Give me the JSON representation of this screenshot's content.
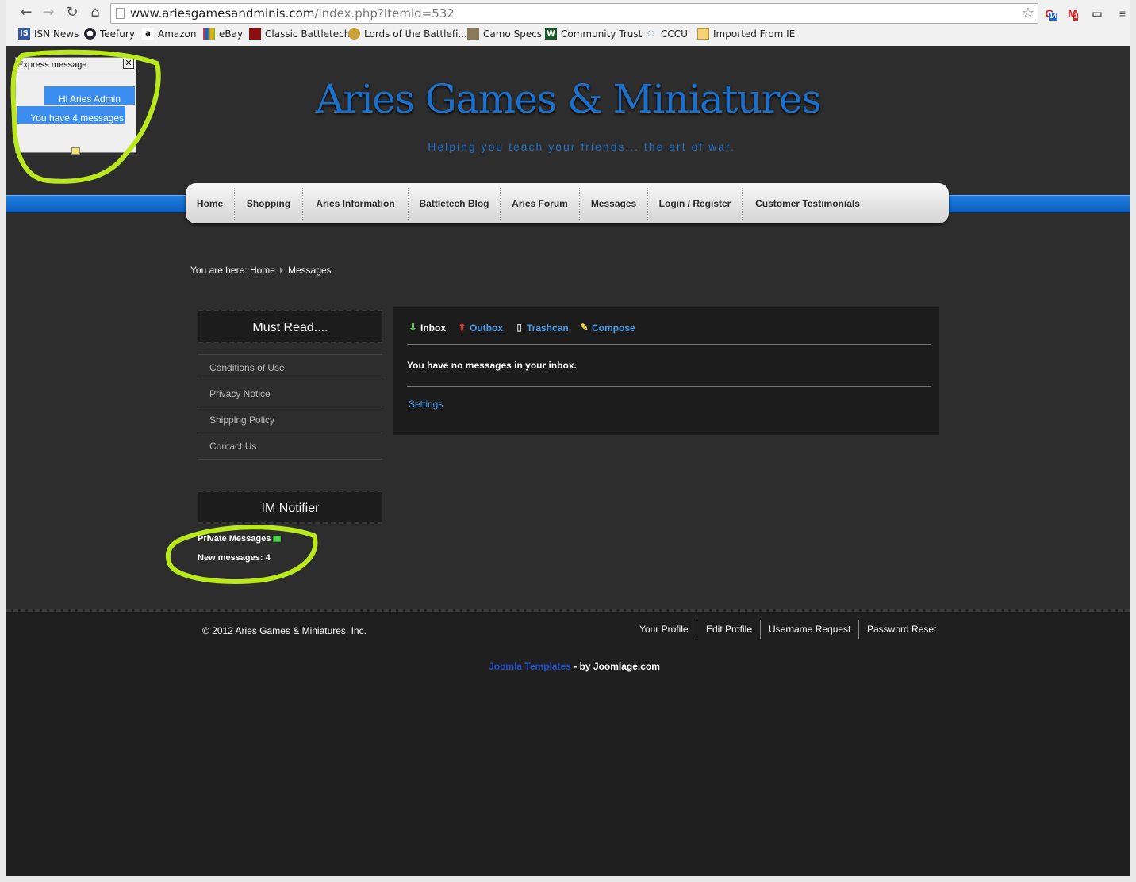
{
  "browser": {
    "url_host": "www.ariesgamesandminis.com",
    "url_path": "/index.php?Itemid=532",
    "ext_badge_1": "14",
    "ext_badge_2": "1",
    "bookmarks": [
      {
        "label": "ISN News",
        "icon": "isn-icon"
      },
      {
        "label": "Teefury",
        "icon": "teefury-icon"
      },
      {
        "label": "Amazon",
        "icon": "amazon-icon"
      },
      {
        "label": "eBay",
        "icon": "ebay-icon"
      },
      {
        "label": "Classic Battletech",
        "icon": "battletech-icon"
      },
      {
        "label": "Lords of the Battlefi...",
        "icon": "lords-icon"
      },
      {
        "label": "Camo Specs",
        "icon": "camo-icon"
      },
      {
        "label": "Community Trust",
        "icon": "community-trust-icon"
      },
      {
        "label": "CCCU",
        "icon": "cccu-icon"
      },
      {
        "label": "Imported From IE",
        "icon": "folder-icon"
      }
    ]
  },
  "site": {
    "title": "Aries Games & Miniatures",
    "slogan": "Helping you teach your friends... the art of war."
  },
  "menu": [
    "Home",
    "Shopping",
    "Aries Information",
    "Battletech Blog",
    "Aries Forum",
    "Messages",
    "Login / Register",
    "Customer Testimonials"
  ],
  "breadcrumb": {
    "prefix": "You are here:",
    "home": "Home",
    "current": "Messages"
  },
  "sidebar": {
    "must_read_title": "Must Read....",
    "links": [
      "Conditions of Use",
      "Privacy Notice",
      "Shipping Policy",
      "Contact Us"
    ],
    "im_title": "IM Notifier",
    "im_private": "Private Messages",
    "im_new": "New messages: 4"
  },
  "messages": {
    "tabs": [
      "Inbox",
      "Outbox",
      "Trashcan",
      "Compose"
    ],
    "empty_text": "You have no messages in your inbox.",
    "settings": "Settings"
  },
  "footer": {
    "copyright": "© 2012 Aries Games & Miniatures, Inc.",
    "links": [
      "Your Profile",
      "Edit Profile",
      "Username Request",
      "Password Reset"
    ],
    "credit_link": "Joomla Templates",
    "credit_suffix": " - by Joomlage.com"
  },
  "popup": {
    "title": "Express message",
    "greeting": "Hi Aries Admin",
    "message": "You have 4 messages"
  },
  "colors": {
    "accent": "#1e6fc8",
    "annotation": "#b9e81d"
  }
}
